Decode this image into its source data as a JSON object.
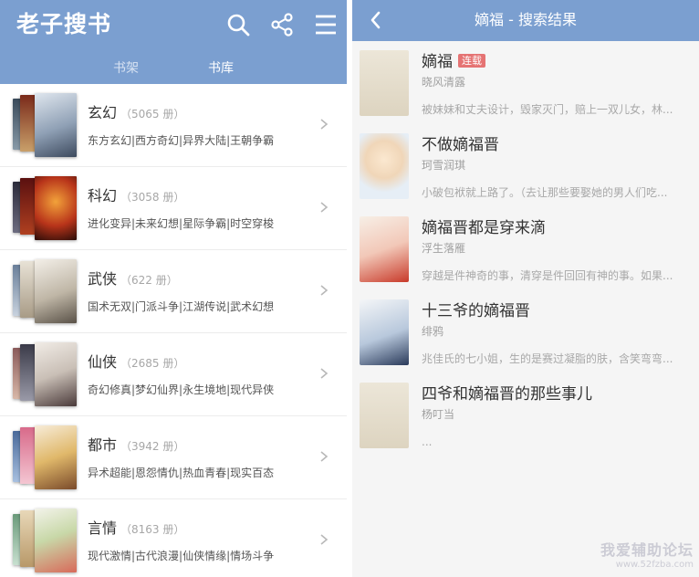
{
  "left": {
    "app_title": "老子搜书",
    "icons": [
      "search-icon",
      "share-icon",
      "menu-icon"
    ],
    "tabs": [
      {
        "label": "书架",
        "active": false
      },
      {
        "label": "书库",
        "active": true
      }
    ],
    "categories": [
      {
        "name": "玄幻",
        "count": "（5065 册）",
        "tags": "东方玄幻|西方奇幻|异界大陆|王朝争霸"
      },
      {
        "name": "科幻",
        "count": "（3058 册）",
        "tags": "进化变异|未来幻想|星际争霸|时空穿梭"
      },
      {
        "name": "武侠",
        "count": "（622 册）",
        "tags": "国术无双|门派斗争|江湖传说|武术幻想"
      },
      {
        "name": "仙侠",
        "count": "（2685 册）",
        "tags": "奇幻修真|梦幻仙界|永生境地|现代异侠"
      },
      {
        "name": "都市",
        "count": "（3942 册）",
        "tags": "异术超能|恩怨情仇|热血青春|现实百态"
      },
      {
        "name": "言情",
        "count": "（8163 册）",
        "tags": "现代激情|古代浪漫|仙侠情缘|情场斗争"
      }
    ]
  },
  "right": {
    "title": "嫡福 - 搜索结果",
    "results": [
      {
        "title": "嫡福",
        "badge": "连载",
        "author": "晓风清露",
        "desc": "被妹妹和丈夫设计，毁家灭门，赔上一双儿女，林..."
      },
      {
        "title": "不做嫡福晋",
        "badge": "",
        "author": "珂雪润琪",
        "desc": "小破包袱就上路了。（去让那些要娶她的男人们吃..."
      },
      {
        "title": "嫡福晋都是穿来滴",
        "badge": "",
        "author": "浮生落雁",
        "desc": "穿越是件神奇的事，清穿是件回回有神的事。如果..."
      },
      {
        "title": "十三爷的嫡福晋",
        "badge": "",
        "author": "绯鸦",
        "desc": "兆佳氏的七小姐，生的是赛过凝脂的肤，含笑弯弯..."
      },
      {
        "title": "四爷和嫡福晋的那些事儿",
        "badge": "",
        "author": "杨叮当",
        "desc": "..."
      }
    ]
  },
  "watermark": {
    "line1": "我爱辅助论坛",
    "line2": "www.52fzba.com"
  },
  "colors": {
    "header": "#7b9fd0",
    "badge": "#e57373"
  }
}
